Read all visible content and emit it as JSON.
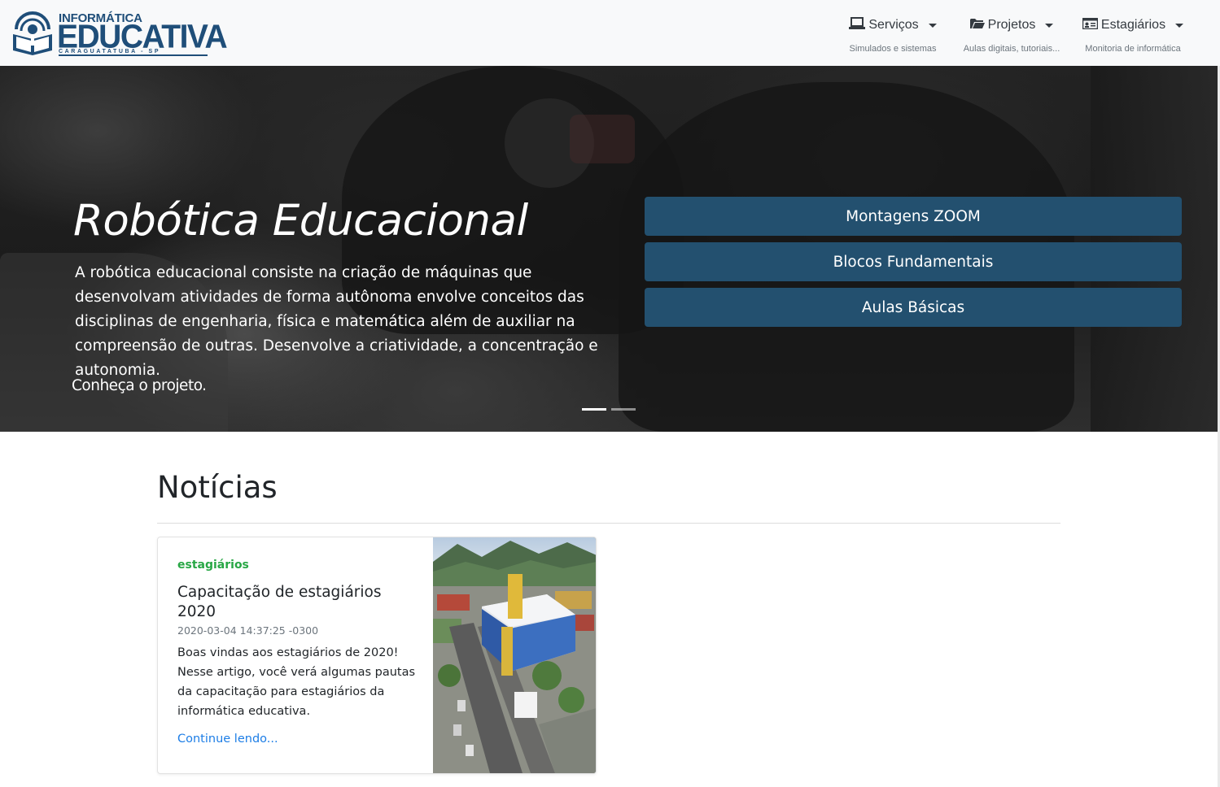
{
  "navbar": {
    "logo": {
      "top_text": "INFORMÁTICA",
      "main_text": "EDUCATIVA",
      "sub_text": "CARAGUATATUBA - SP",
      "brand_color": "#1f4e79"
    },
    "items": [
      {
        "label": "Serviços",
        "subtitle": "Simulados e sistemas",
        "icon": "laptop-icon"
      },
      {
        "label": "Projetos",
        "subtitle": "Aulas digitais, tutoriais...",
        "icon": "folder-open-icon"
      },
      {
        "label": "Estagiários",
        "subtitle": "Monitoria de informática",
        "icon": "id-card-icon"
      }
    ]
  },
  "hero": {
    "title": "Robótica Educacional",
    "text": "A robótica educacional consiste na criação de máquinas que desenvolvam atividades de forma autônoma envolve conceitos das disciplinas de engenharia, física e matemática além de auxiliar na compreensão de outras. Desenvolve a criatividade, a concentração e autonomia.",
    "cta": "Conheça o projeto.",
    "buttons": [
      "Montagens ZOOM",
      "Blocos Fundamentais",
      "Aulas Básicas"
    ],
    "button_color": "#23506f",
    "slides_count": 2,
    "active_slide": 1
  },
  "news": {
    "heading": "Notícias",
    "cards": [
      {
        "category": "estagiários",
        "title": "Capacitação de estagiários 2020",
        "date": "2020-03-04 14:37:25 -0300",
        "excerpt": "Boas vindas aos estagiários de 2020! Nesse artigo, você verá algumas pautas da capacitação para estagiários da informática educativa.",
        "link_text": "Continue lendo...",
        "category_color": "#28a745"
      }
    ]
  }
}
